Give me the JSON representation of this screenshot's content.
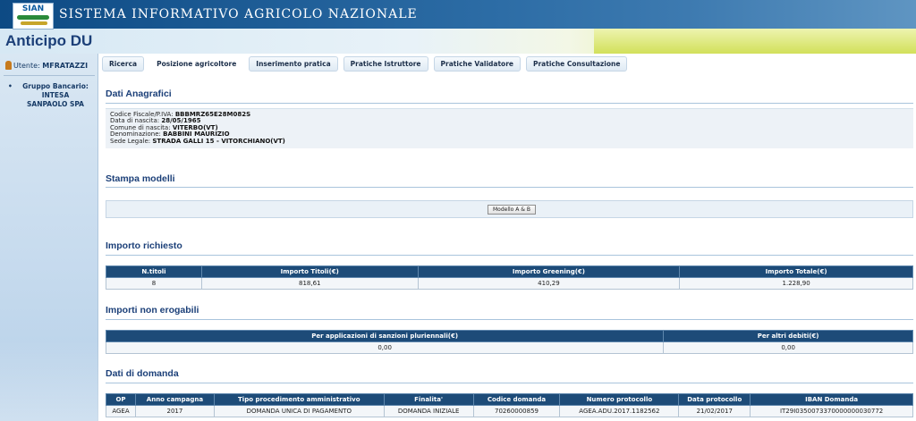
{
  "header": {
    "logo_text": "SIAN",
    "app_name": "SISTEMA INFORMATIVO AGRICOLO NAZIONALE",
    "page_title": "Anticipo DU"
  },
  "sidebar": {
    "user_label": "Utente:",
    "user_name": "MFRATAZZI",
    "bank_label": "Gruppo Bancario:",
    "bank_value_1": "INTESA",
    "bank_value_2": "SANPAOLO SPA"
  },
  "nav": {
    "items": [
      {
        "label": "Ricerca",
        "active": false
      },
      {
        "label": "Posizione agricoltore",
        "active": true
      },
      {
        "label": "Inserimento pratica",
        "active": false
      },
      {
        "label": "Pratiche Istruttore",
        "active": false
      },
      {
        "label": "Pratiche Validatore",
        "active": false
      },
      {
        "label": "Pratiche Consultazione",
        "active": false
      }
    ]
  },
  "anagrafici": {
    "title": "Dati Anagrafici",
    "codice_fiscale_label": "Codice Fiscale/P.IVA:",
    "codice_fiscale": "BBBMRZ65E28M082S",
    "data_nascita_label": "Data di nascita:",
    "data_nascita": "28/05/1965",
    "comune_label": "Comune di nascita:",
    "comune": "VITERBO(VT)",
    "denominazione_label": "Denominazione:",
    "denominazione": "BABBINI MAURIZIO",
    "sede_label": "Sede Legale:",
    "sede": "STRADA GALLI 15 - VITORCHIANO(VT)"
  },
  "stampa": {
    "title": "Stampa modelli",
    "button_label": "Modello A & B"
  },
  "importo_richiesto": {
    "title": "Importo richiesto",
    "headers": [
      "N.titoli",
      "Importo Titoli(€)",
      "Importo Greening(€)",
      "Importo Totale(€)"
    ],
    "row": [
      "8",
      "818,61",
      "410,29",
      "1.228,90"
    ]
  },
  "non_erogabili": {
    "title": "Importi non erogabili",
    "headers": [
      "Per applicazioni di sanzioni pluriennali(€)",
      "Per altri debiti(€)"
    ],
    "row": [
      "0,00",
      "0,00"
    ]
  },
  "domanda": {
    "title": "Dati di domanda",
    "headers": [
      "OP",
      "Anno campagna",
      "Tipo procedimento amministrativo",
      "Finalita'",
      "Codice domanda",
      "Numero protocollo",
      "Data protocollo",
      "IBAN Domanda"
    ],
    "row": [
      "AGEA",
      "2017",
      "DOMANDA UNICA DI PAGAMENTO",
      "DOMANDA INIZIALE",
      "70260000859",
      "AGEA.ADU.2017.1182562",
      "21/02/2017",
      "IT29I0350073370000000030772"
    ]
  }
}
